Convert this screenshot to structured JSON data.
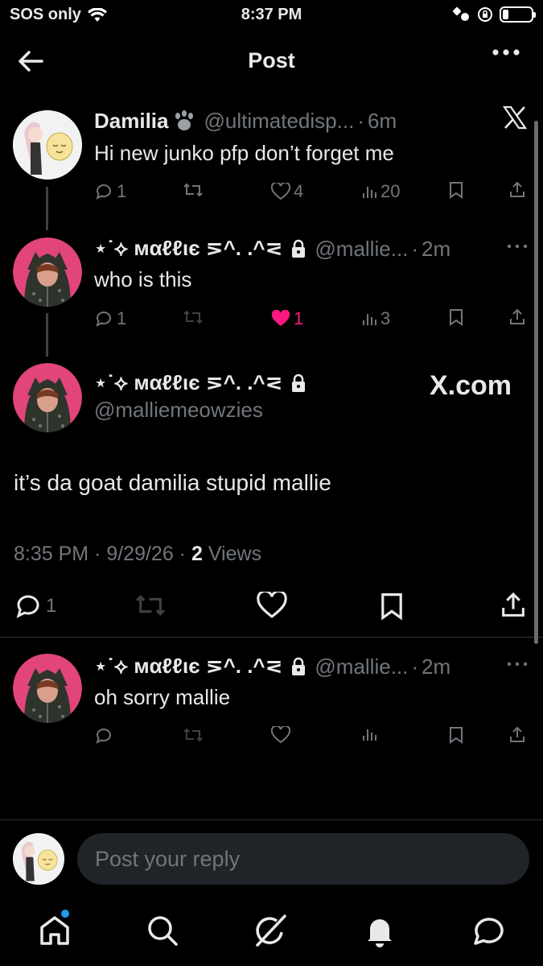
{
  "status_bar": {
    "carrier": "SOS only",
    "time": "8:37 PM"
  },
  "header": {
    "title": "Post"
  },
  "tweets": [
    {
      "name": "Damilia",
      "handle": "@ultimatedisp...",
      "time": "6m",
      "text": "Hi new junko pfp don’t forget me",
      "replies": "1",
      "likes": "4",
      "views": "20"
    },
    {
      "name": "⋆˙⟡ ᴍαℓℓιє ⋝^. .^⋜",
      "handle": "@mallie...",
      "time": "2m",
      "text": "who is this",
      "replies": "1",
      "likes": "1",
      "views": "3"
    }
  ],
  "main_post": {
    "name": "⋆˙⟡ ᴍαℓℓιє ⋝^. .^⋜",
    "handle": "@malliemeowzies",
    "watermark": "X.com",
    "text": "it’s da goat damilia stupid mallie",
    "timestamp": "8:35 PM · 9/29/26 ·",
    "views_count": "2",
    "views_label": "Views",
    "replies": "1"
  },
  "reply_tweet": {
    "name": "⋆˙⟡ ᴍαℓℓιє ⋝^. .^⋜",
    "handle": "@mallie...",
    "time": "2m",
    "text": "oh sorry mallie"
  },
  "reply_box": {
    "placeholder": "Post your reply"
  },
  "colors": {
    "background": "#000000",
    "text": "#e7e9ea",
    "muted": "#71767b",
    "like_pink": "#f91880",
    "notification_dot": "#1d9bf0"
  }
}
